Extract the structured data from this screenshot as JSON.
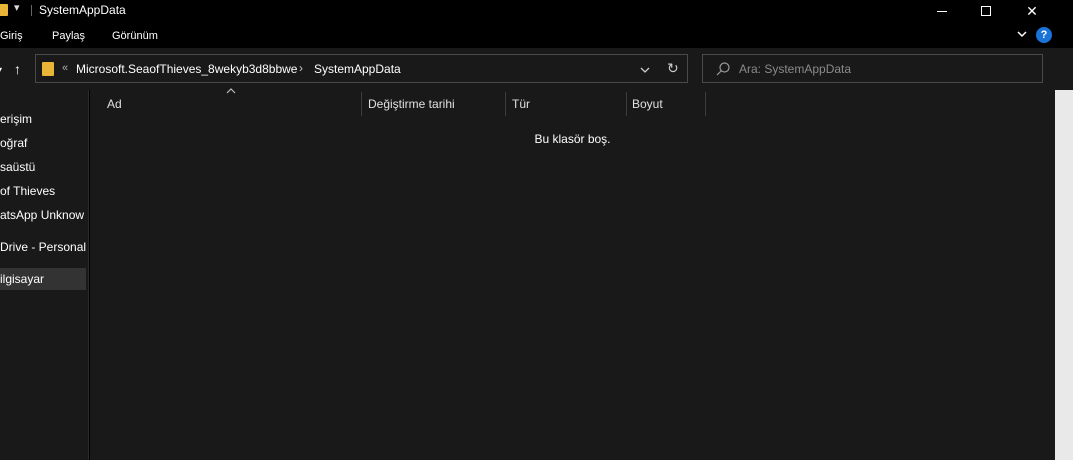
{
  "window": {
    "title": "SystemAppData",
    "quick_access_symbol": "▾",
    "minimize_icon": "minimize-icon",
    "maximize_icon": "maximize-icon",
    "close_glyph": "✕"
  },
  "ribbon": {
    "tabs": [
      {
        "label": "Giriş"
      },
      {
        "label": "Paylaş"
      },
      {
        "label": "Görünüm"
      }
    ],
    "help_label": "?"
  },
  "navigation": {
    "back_glyph": "▾",
    "up_glyph": "↑",
    "address": {
      "overflow": "«",
      "segments": [
        "Microsoft.SeaofThieves_8wekyb3d8bbwe",
        "SystemAppData"
      ],
      "separator": "›",
      "refresh_glyph": "↻"
    },
    "search": {
      "placeholder": "Ara: SystemAppData",
      "value": ""
    }
  },
  "sidebar": {
    "items": [
      {
        "label": "erişim",
        "selected": false
      },
      {
        "label": "oğraf",
        "selected": false
      },
      {
        "label": "saüstü",
        "selected": false
      },
      {
        "label": " of Thieves",
        "selected": false
      },
      {
        "label": "atsApp Unknow",
        "selected": false
      },
      {
        "label": "Drive - Personal",
        "selected": false
      },
      {
        "label": "ilgisayar",
        "selected": true
      }
    ]
  },
  "file_list": {
    "columns": [
      {
        "label": "Ad"
      },
      {
        "label": "Değiştirme tarihi"
      },
      {
        "label": "Tür"
      },
      {
        "label": "Boyut"
      }
    ],
    "sort_column": "Ad",
    "empty_message": "Bu klasör boş."
  },
  "colors": {
    "background": "#191919",
    "titlebar": "#000000",
    "folder": "#e8b537",
    "help_accent": "#1a73d8",
    "selected": "#333333"
  }
}
